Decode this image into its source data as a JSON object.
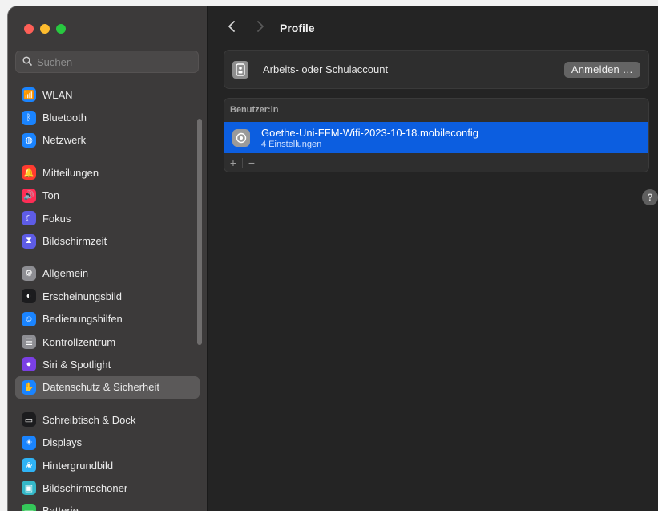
{
  "window": {
    "title": "Profile"
  },
  "search": {
    "placeholder": "Suchen",
    "value": ""
  },
  "sidebar": {
    "groups": [
      [
        {
          "id": "wlan",
          "label": "WLAN",
          "icon": "wifi-icon",
          "color": "#1a84ff",
          "glyph": "📶"
        },
        {
          "id": "bluetooth",
          "label": "Bluetooth",
          "icon": "bluetooth-icon",
          "color": "#1a84ff",
          "glyph": "ᛒ"
        },
        {
          "id": "netzwerk",
          "label": "Netzwerk",
          "icon": "globe-icon",
          "color": "#1a84ff",
          "glyph": "◍"
        }
      ],
      [
        {
          "id": "mitteilungen",
          "label": "Mitteilungen",
          "icon": "bell-icon",
          "color": "#ff3b30",
          "glyph": "🔔"
        },
        {
          "id": "ton",
          "label": "Ton",
          "icon": "speaker-icon",
          "color": "#ff2d55",
          "glyph": "🔊"
        },
        {
          "id": "fokus",
          "label": "Fokus",
          "icon": "moon-icon",
          "color": "#5e5ce6",
          "glyph": "☾"
        },
        {
          "id": "bildschirmzeit",
          "label": "Bildschirmzeit",
          "icon": "hourglass-icon",
          "color": "#5e5ce6",
          "glyph": "⧗"
        }
      ],
      [
        {
          "id": "allgemein",
          "label": "Allgemein",
          "icon": "gear-icon",
          "color": "#8e8e93",
          "glyph": "⚙"
        },
        {
          "id": "erscheinungsbild",
          "label": "Erscheinungsbild",
          "icon": "appearance-icon",
          "color": "#1c1c1e",
          "glyph": "◐"
        },
        {
          "id": "bedienungshilfen",
          "label": "Bedienungshilfen",
          "icon": "accessibility-icon",
          "color": "#1a84ff",
          "glyph": "☺"
        },
        {
          "id": "kontrollzentrum",
          "label": "Kontrollzentrum",
          "icon": "toggles-icon",
          "color": "#8e8e93",
          "glyph": "☰"
        },
        {
          "id": "siri",
          "label": "Siri & Spotlight",
          "icon": "siri-icon",
          "color": "#7b3fe4",
          "glyph": "●"
        },
        {
          "id": "datenschutz",
          "label": "Datenschutz & Sicherheit",
          "icon": "hand-icon",
          "color": "#1a84ff",
          "glyph": "✋",
          "active": true
        }
      ],
      [
        {
          "id": "dock",
          "label": "Schreibtisch & Dock",
          "icon": "dock-icon",
          "color": "#1c1c1e",
          "glyph": "▭"
        },
        {
          "id": "displays",
          "label": "Displays",
          "icon": "sun-icon",
          "color": "#1a84ff",
          "glyph": "☀"
        },
        {
          "id": "hintergrundbild",
          "label": "Hintergrundbild",
          "icon": "flower-icon",
          "color": "#2fb3f5",
          "glyph": "❀"
        },
        {
          "id": "bildschirmschoner",
          "label": "Bildschirmschoner",
          "icon": "screensaver-icon",
          "color": "#35b8c8",
          "glyph": "▣"
        },
        {
          "id": "batterie",
          "label": "Batterie",
          "icon": "battery-icon",
          "color": "#34c759",
          "glyph": "▬"
        }
      ]
    ]
  },
  "account": {
    "label": "Arbeits- oder Schulaccount",
    "button": "Anmelden …"
  },
  "users": {
    "header": "Benutzer:in",
    "profile": {
      "name": "Goethe-Uni-FFM-Wifi-2023-10-18.mobileconfig",
      "subtitle": "4 Einstellungen"
    },
    "add": "+",
    "remove": "−"
  },
  "help": {
    "label": "?"
  },
  "colors": {
    "selection": "#0c5ee0",
    "sidebar_active": "#5b5959"
  }
}
